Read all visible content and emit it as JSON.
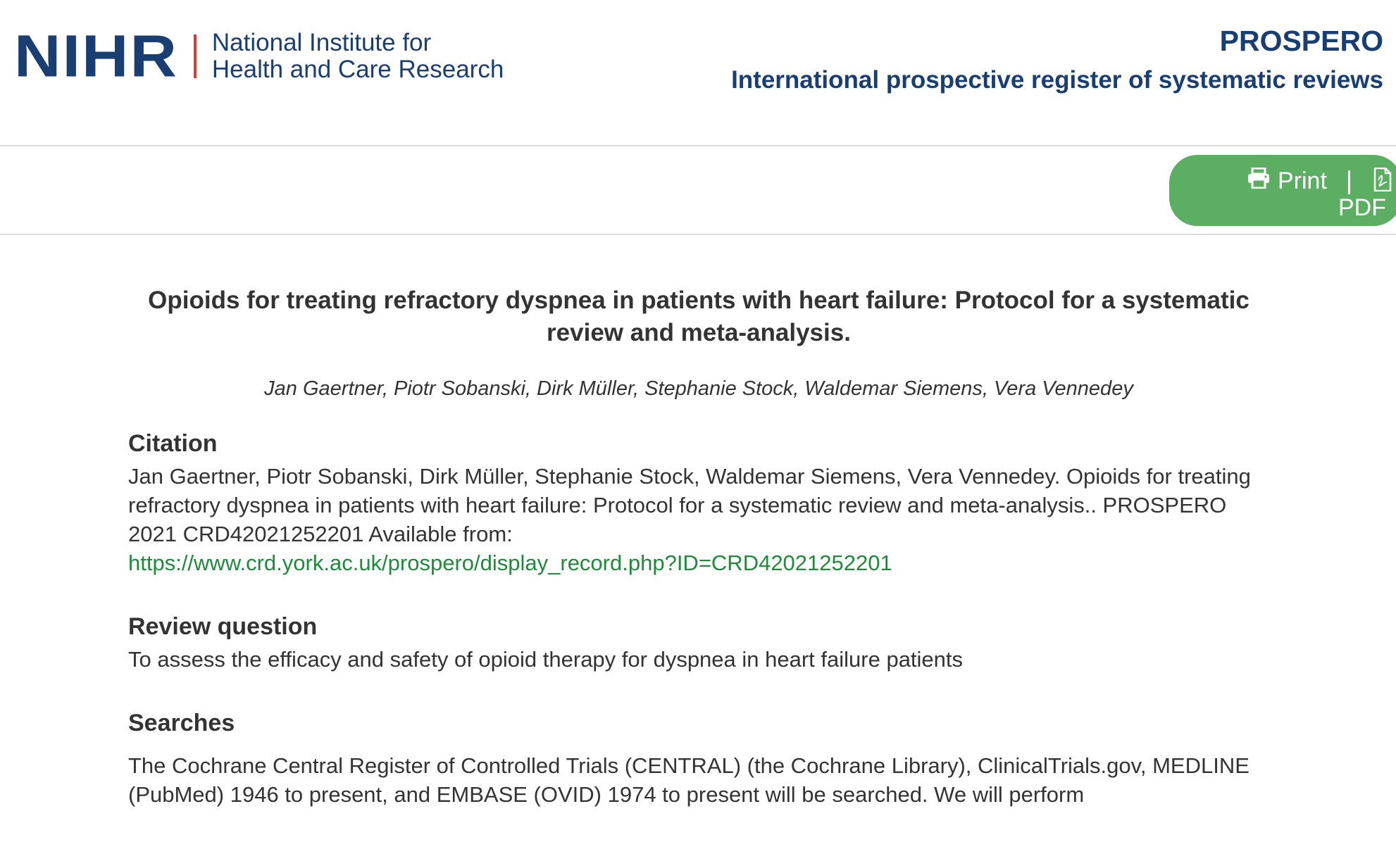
{
  "header": {
    "logo_mark": "NIHR",
    "logo_text_line1": "National Institute for",
    "logo_text_line2": "Health and Care Research",
    "brand_name": "PROSPERO",
    "brand_tagline": "International prospective register of systematic reviews"
  },
  "toolbar": {
    "print_label": "Print",
    "pdf_label": "PDF",
    "accent_color": "#5cae62"
  },
  "record": {
    "title": "Opioids for treating refractory dyspnea in patients with heart failure: Protocol for a systematic review and meta-analysis.",
    "authors": "Jan Gaertner, Piotr Sobanski, Dirk Müller, Stephanie Stock, Waldemar Siemens, Vera Vennedey"
  },
  "citation": {
    "heading": "Citation",
    "text": "Jan Gaertner, Piotr Sobanski, Dirk Müller, Stephanie Stock, Waldemar Siemens, Vera Vennedey. Opioids for treating refractory dyspnea in patients with heart failure: Protocol for a systematic review and meta-analysis.. PROSPERO 2021 CRD42021252201 Available from:",
    "link": "https://www.crd.york.ac.uk/prospero/display_record.php?ID=CRD42021252201"
  },
  "review_question": {
    "heading": "Review question",
    "text": "To assess the efficacy and safety of opioid therapy for dyspnea in heart failure patients"
  },
  "searches": {
    "heading": "Searches",
    "text": "The Cochrane Central Register of Controlled Trials (CENTRAL) (the Cochrane Library), ClinicalTrials.gov, MEDLINE (PubMed) 1946 to present, and EMBASE (OVID) 1974 to present will be searched. We will perform"
  },
  "colors": {
    "brand_blue": "#193e72",
    "logo_divider": "#e5382c",
    "link_green": "#1f8a3b"
  }
}
